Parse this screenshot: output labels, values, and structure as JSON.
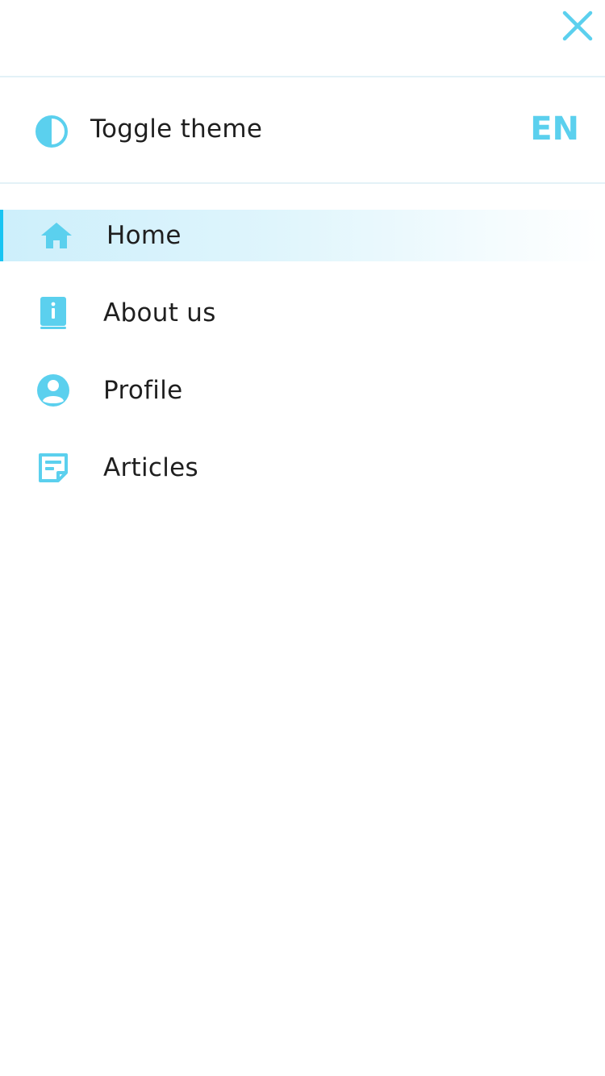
{
  "colors": {
    "accent": "#5bd0ee",
    "active_bar": "#18c4f2",
    "active_bg": "#cdeffb",
    "divider": "#e3f1f7",
    "text": "#1f1f1f"
  },
  "header": {
    "close_icon": "close-icon"
  },
  "theme": {
    "icon": "contrast-icon",
    "label": "Toggle theme"
  },
  "language": {
    "label": "EN"
  },
  "nav": {
    "items": [
      {
        "label": "Home",
        "icon": "home-icon",
        "active": true
      },
      {
        "label": "About us",
        "icon": "info-book-icon",
        "active": false
      },
      {
        "label": "Profile",
        "icon": "account-circle-icon",
        "active": false
      },
      {
        "label": "Articles",
        "icon": "sticky-note-icon",
        "active": false
      }
    ]
  }
}
